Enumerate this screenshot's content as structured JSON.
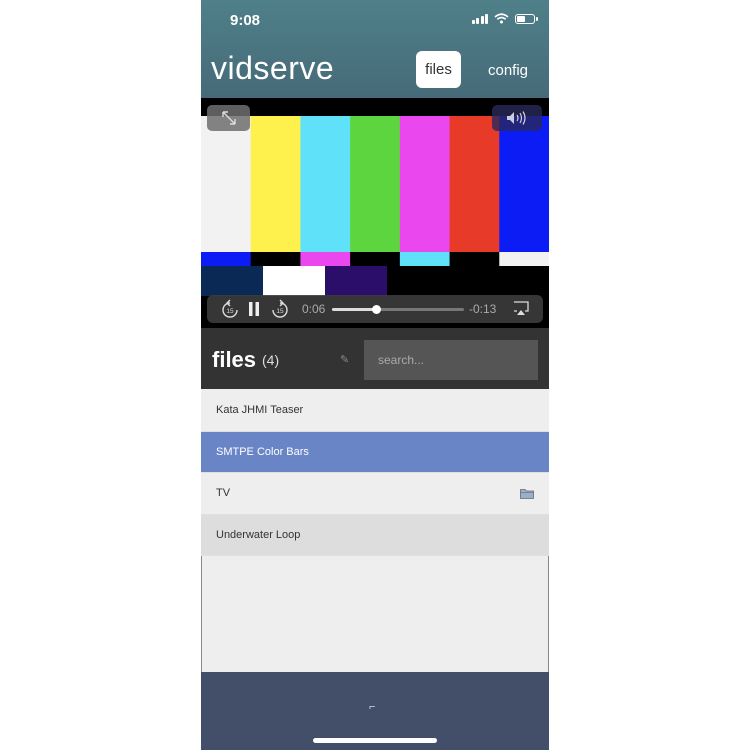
{
  "status_bar": {
    "time": "9:08",
    "icons": [
      "signal-icon",
      "wifi-icon",
      "battery-icon"
    ],
    "battery_level": 0.55
  },
  "header": {
    "title": "vidserve",
    "nav": [
      {
        "label": "files",
        "active": true
      },
      {
        "label": "config",
        "active": false
      }
    ]
  },
  "player": {
    "fullscreen_icon": "expand-icon",
    "volume_icon": "speaker-icon",
    "controls": {
      "rewind_icon": "rewind-15-icon",
      "pause_icon": "pause-icon",
      "forward_icon": "forward-15-icon",
      "airplay_icon": "airplay-icon",
      "elapsed": "0:06",
      "remaining": "-0:13",
      "progress": 0.33
    },
    "color_bars": {
      "main": [
        "#f2f2f2",
        "#fef04d",
        "#60e1fa",
        "#5dd53e",
        "#ea47ee",
        "#e83a28",
        "#0b1cf5"
      ],
      "mid": [
        "#0b1cf5",
        "#000000",
        "#ea47ee",
        "#000000",
        "#60e1fa",
        "#000000",
        "#f2f2f2"
      ],
      "low": [
        "#0a2a55",
        "#ffffff",
        "#2b0d6a",
        "#000000",
        "#000000"
      ]
    }
  },
  "files_panel": {
    "title": "files",
    "count": "(4)",
    "edit_icon": "pencil-icon",
    "search": {
      "placeholder": "search...",
      "value": ""
    }
  },
  "files": [
    {
      "name": "Kata JHMI Teaser",
      "selected": false,
      "icon": ""
    },
    {
      "name": "SMTPE Color Bars",
      "selected": true,
      "icon": ""
    },
    {
      "name": "TV",
      "selected": false,
      "icon": "folder-icon"
    },
    {
      "name": "Underwater Loop",
      "selected": false,
      "icon": ""
    }
  ],
  "footer": {
    "icon": "corner-bracket-icon"
  },
  "colors": {
    "header_bg": "#4f7f88",
    "selected_row": "#6a85c6",
    "files_bar_bg": "#333333",
    "footer_bg": "#434f68"
  }
}
